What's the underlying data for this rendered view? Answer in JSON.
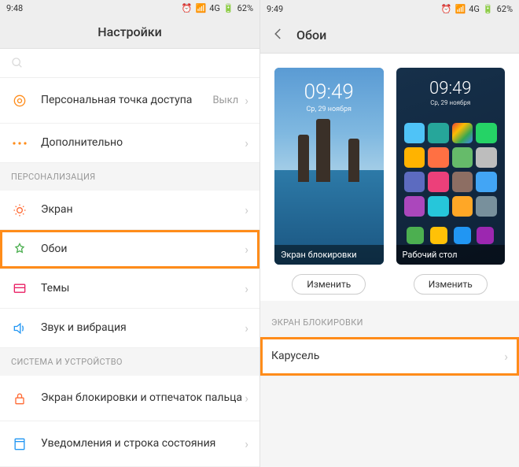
{
  "left": {
    "status": {
      "time": "9:48",
      "network": "4G",
      "battery": "62%"
    },
    "title": "Настройки",
    "items_top": [
      {
        "label": "Персональная точка доступа",
        "value": "Выкл",
        "icon": "hotspot"
      },
      {
        "label": "Дополнительно",
        "icon": "more"
      }
    ],
    "section_personalization": "ПЕРСОНАЛИЗАЦИЯ",
    "items_pers": [
      {
        "label": "Экран",
        "icon": "display"
      },
      {
        "label": "Обои",
        "icon": "wallpaper",
        "highlight": true
      },
      {
        "label": "Темы",
        "icon": "themes"
      },
      {
        "label": "Звук и вибрация",
        "icon": "sound"
      }
    ],
    "section_system": "СИСТЕМА И УСТРОЙСТВО",
    "items_sys": [
      {
        "label": "Экран блокировки и отпечаток пальца",
        "icon": "lock"
      },
      {
        "label": "Уведомления и строка состояния",
        "icon": "notif"
      }
    ]
  },
  "right": {
    "status": {
      "time": "9:49",
      "network": "4G",
      "battery": "62%"
    },
    "title": "Обои",
    "lock_time": "09:49",
    "lock_date": "Ср, 29 ноября",
    "home_time": "09:49",
    "home_date": "Ср, 29 ноября",
    "caption_lock": "Экран блокировки",
    "caption_home": "Рабочий стол",
    "change_btn": "Изменить",
    "section_lock": "ЭКРАН БЛОКИРОВКИ",
    "carousel": "Карусель"
  }
}
